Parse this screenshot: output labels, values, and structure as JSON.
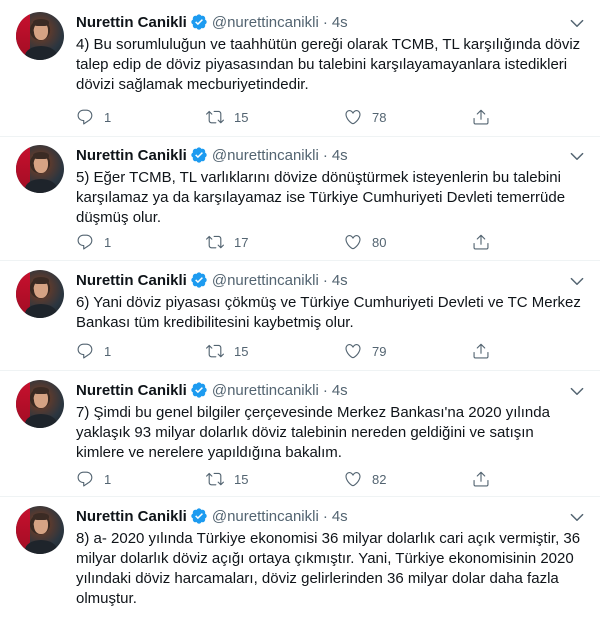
{
  "tweets": [
    {
      "name": "Nurettin Canikli",
      "handle": "@nurettincanikli",
      "dot": "·",
      "time": "4s",
      "text": "4) Bu sorumluluğun ve taahhütün gereği olarak TCMB, TL karşılığında döviz talep edip de döviz piyasasından bu talebini karşılayamayanlara istedikleri dövizi sağlamak mecburiyetindedir.",
      "replies": "1",
      "retweets": "15",
      "likes": "78"
    },
    {
      "name": "Nurettin Canikli",
      "handle": "@nurettincanikli",
      "dot": "·",
      "time": "4s",
      "text": "5) Eğer TCMB, TL varlıklarını dövize dönüştürmek isteyenlerin bu talebini karşılamaz ya da karşılayamaz ise Türkiye Cumhuriyeti Devleti temerrüde düşmüş olur.",
      "replies": "1",
      "retweets": "17",
      "likes": "80"
    },
    {
      "name": "Nurettin Canikli",
      "handle": "@nurettincanikli",
      "dot": "·",
      "time": "4s",
      "text": "6) Yani döviz piyasası çökmüş ve Türkiye Cumhuriyeti Devleti ve TC Merkez Bankası tüm kredibilitesini kaybetmiş olur.",
      "replies": "1",
      "retweets": "15",
      "likes": "79"
    },
    {
      "name": "Nurettin Canikli",
      "handle": "@nurettincanikli",
      "dot": "·",
      "time": "4s",
      "text": "7) Şimdi bu genel bilgiler çerçevesinde Merkez Bankası'na 2020 yılında yaklaşık 93 milyar dolarlık döviz talebinin nereden geldiğini ve satışın kimlere ve nerelere yapıldığına bakalım.",
      "replies": "1",
      "retweets": "15",
      "likes": "82"
    },
    {
      "name": "Nurettin Canikli",
      "handle": "@nurettincanikli",
      "dot": "·",
      "time": "4s",
      "text": "8) a- 2020 yılında Türkiye ekonomisi 36 milyar dolarlık cari açık vermiştir, 36 milyar dolarlık döviz açığı ortaya çıkmıştır. Yani, Türkiye ekonomisinin 2020 yılındaki döviz harcamaları, döviz gelirlerinden 36 milyar dolar daha fazla olmuştur."
    }
  ],
  "icons": {
    "verified": "verified-badge-icon",
    "caret": "chevron-down-icon",
    "reply": "reply-icon",
    "retweet": "retweet-icon",
    "like": "heart-icon",
    "share": "share-icon"
  },
  "colors": {
    "accent": "#1d9bf0",
    "text": "#0f1419",
    "muted": "#536471",
    "divider": "#eff3f4"
  }
}
